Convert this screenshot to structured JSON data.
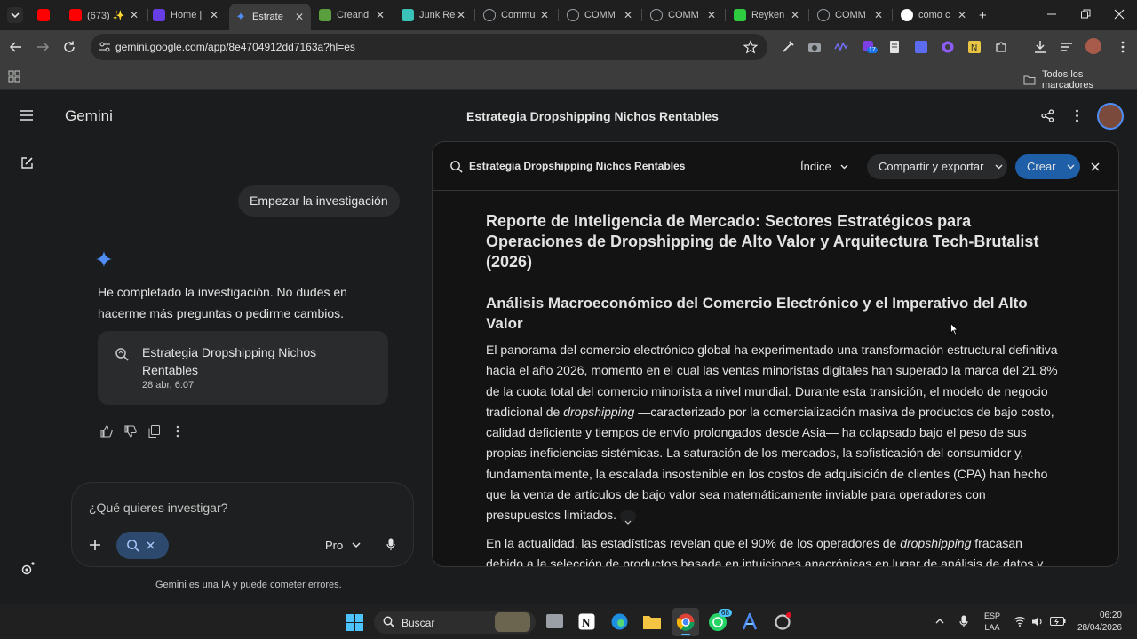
{
  "browser": {
    "tabs": [
      {
        "title": "",
        "icon": "youtube-icon",
        "color": "#ff0000"
      },
      {
        "title": "(673) ✨",
        "icon": "youtube-icon",
        "color": "#ff0000"
      },
      {
        "title": "Home |",
        "icon": "hostinger-icon",
        "color": "#673de6"
      },
      {
        "title": "Estrate",
        "icon": "gemini-icon",
        "color": "#4f8df5",
        "active": true
      },
      {
        "title": "Creand",
        "icon": "shopify-icon",
        "color": "#5a9e3d"
      },
      {
        "title": "Junk Re",
        "icon": "tool-icon",
        "color": "#3bc2b8"
      },
      {
        "title": "Commu",
        "icon": "globe-icon",
        "color": "#9aa0a6"
      },
      {
        "title": "COMM",
        "icon": "globe-icon",
        "color": "#9aa0a6"
      },
      {
        "title": "COMM",
        "icon": "globe-icon",
        "color": "#9aa0a6"
      },
      {
        "title": "Reyken",
        "icon": "k-icon",
        "color": "#2ecc40"
      },
      {
        "title": "COMM",
        "icon": "globe-icon",
        "color": "#9aa0a6"
      },
      {
        "title": "como c",
        "icon": "google-icon",
        "color": "#4285f4"
      }
    ],
    "url": "gemini.google.com/app/8e4704912dd7163a?hl=es",
    "bookmarks_label": "Todos los marcadores",
    "extension_badge": "17"
  },
  "app": {
    "brand": "Gemini",
    "conversation_title": "Estrategia Dropshipping Nichos Rentables",
    "user_message": "Empezar la investigación",
    "answer_text": "He completado la investigación. No dudes en hacerme más preguntas o pedirme cambios.",
    "doc_card": {
      "title": "Estrategia Dropshipping Nichos Rentables",
      "date": "28 abr, 6:07"
    },
    "input": {
      "placeholder": "¿Qué quieres investigar?",
      "model": "Pro"
    },
    "disclaimer": "Gemini es una IA y puede cometer errores."
  },
  "canvas": {
    "title": "Estrategia Dropshipping Nichos Rentables",
    "index_label": "Índice",
    "share_label": "Compartir y exportar",
    "create_label": "Crear",
    "h1": "Reporte de Inteligencia de Mercado: Sectores Estratégicos para Operaciones de Dropshipping de Alto Valor y Arquitectura Tech-Brutalist (2026)",
    "h2": "Análisis Macroeconómico del Comercio Electrónico y el Imperativo del Alto Valor",
    "p1_a": "El panorama del comercio electrónico global ha experimentado una transformación estructural definitiva hacia el año 2026, momento en el cual las ventas minoristas digitales han superado la marca del 21.8% de la cuota total del comercio minorista a nivel mundial. Durante esta transición, el modelo de negocio tradicional de ",
    "p1_em": "dropshipping",
    "p1_b": " —caracterizado por la comercialización masiva de productos de bajo costo, calidad deficiente y tiempos de envío prolongados desde Asia— ha colapsado bajo el peso de sus propias ineficiencias sistémicas. La saturación de los mercados, la sofisticación del consumidor y, fundamentalmente, la escalada insostenible en los costos de adquisición de clientes (CPA) han hecho que la venta de artículos de bajo valor sea matemáticamente inviable para operadores con presupuestos limitados.",
    "p2_a": "En la actualidad, las estadísticas revelan que el 90% de los operadores de ",
    "p2_em": "dropshipping",
    "p2_b": " fracasan debido a la selección de productos basada en intuiciones anacrónicas en lugar de análisis de datos y márgenes"
  },
  "taskbar": {
    "search_label": "Buscar",
    "lang_line1": "ESP",
    "lang_line2": "LAA",
    "time": "06:20",
    "date": "28/04/2026",
    "whatsapp_badge": "68"
  },
  "colors": {
    "accent_blue": "#0b57d0",
    "create_button": "#1f5fa8",
    "chip_blue": "#2d4a6e",
    "gemini_star": "#4f8df5"
  }
}
